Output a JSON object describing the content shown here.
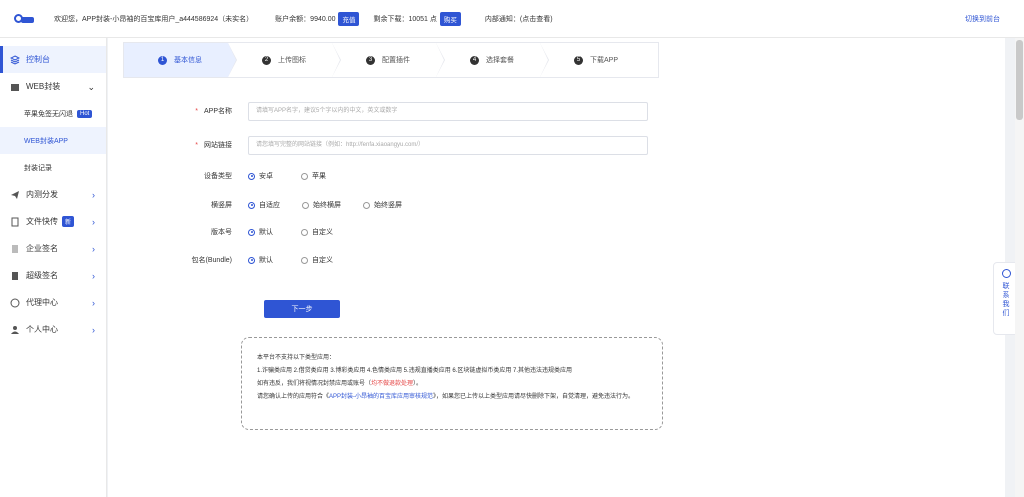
{
  "header": {
    "welcome": "欢迎您，APP封装-小昂袖的百宝库用户_a444586924（未实名）",
    "balance_label": "账户余额：9940.00",
    "recharge_btn": "充值",
    "downloads_label": "剩余下载：10051 点",
    "buy_btn": "购买",
    "notice_label": "内部通知：(点击查看)",
    "switch_front": "切换到前台"
  },
  "sidebar": {
    "items": [
      {
        "label": "控制台",
        "active": true
      },
      {
        "label": "WEB封装"
      },
      {
        "label": "苹果免签无闪退",
        "badge": "Hot"
      },
      {
        "label": "WEB封装APP",
        "active": true
      },
      {
        "label": "封装记录"
      },
      {
        "label": "内测分发"
      },
      {
        "label": "文件快传",
        "badge": "新"
      },
      {
        "label": "企业签名"
      },
      {
        "label": "超级签名"
      },
      {
        "label": "代理中心"
      },
      {
        "label": "个人中心"
      }
    ]
  },
  "steps": [
    {
      "num": "1",
      "label": "基本信息"
    },
    {
      "num": "2",
      "label": "上传图标"
    },
    {
      "num": "3",
      "label": "配置插件"
    },
    {
      "num": "4",
      "label": "选择套餐"
    },
    {
      "num": "5",
      "label": "下载APP"
    }
  ],
  "form": {
    "app_name": {
      "label": "APP名称",
      "placeholder": "请填写APP名字，建议5个字以内的中文，英文或数字"
    },
    "site_url": {
      "label": "网站链接",
      "placeholder": "请您填写完整的网站链接（例如：http://fenfa.xiaoangyu.com/）"
    },
    "device": {
      "label": "设备类型",
      "options": [
        "安卓",
        "苹果"
      ],
      "selected": "安卓"
    },
    "orientation": {
      "label": "横竖屏",
      "options": [
        "自适应",
        "始终横屏",
        "始终竖屏"
      ],
      "selected": "自适应"
    },
    "version": {
      "label": "版本号",
      "options": [
        "默认",
        "自定义"
      ],
      "selected": "默认"
    },
    "bundle": {
      "label": "包名(Bundle)",
      "options": [
        "默认",
        "自定义"
      ],
      "selected": "默认"
    },
    "next_btn": "下一步"
  },
  "notice": {
    "line1": "本平台不支持以下类型应用：",
    "line2": "1.诈骗类应用 2.借贷类应用 3.博彩类应用 4.色情类应用 5.违规直播类应用 6.区块链虚拟币类应用 7.其他违法违规类应用",
    "line3a": "如有违反，我们将视情况封禁应用或账号（",
    "line3_red": "均不做退款处理",
    "line3b": "）。",
    "line4a": "请您确认上传的应用符合《",
    "line4_link": "APP封装-小昂袖的百宝库应用审核规范",
    "line4b": "》，如果您已上传以上类型应用请尽快删除下架，自觉清理，避免违法行为。"
  },
  "contact": {
    "label": "联系我们"
  },
  "colors": {
    "accent": "#2f55d4",
    "danger": "#e54545"
  }
}
